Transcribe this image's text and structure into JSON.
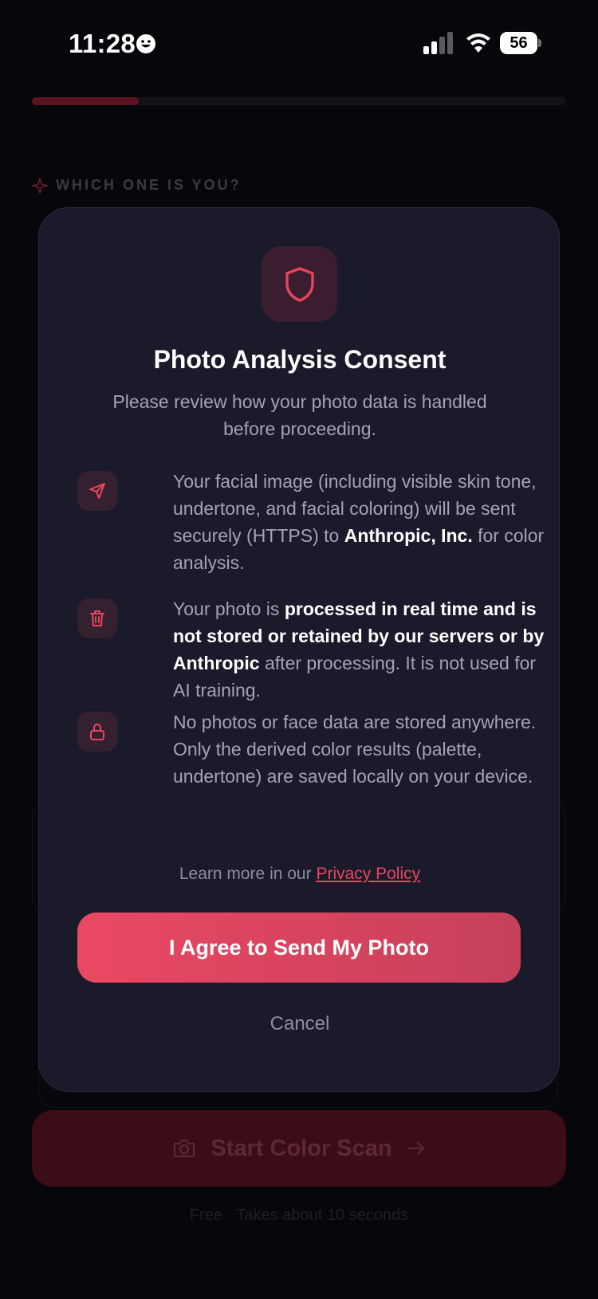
{
  "status_bar": {
    "time": "11:28",
    "battery": "56"
  },
  "progress": {
    "fraction": 0.2
  },
  "background": {
    "section_label": "WHICH ONE IS YOU?",
    "start_button": "Start Color Scan",
    "footnote": "Free · Takes about 10 seconds"
  },
  "modal": {
    "title": "Photo Analysis Consent",
    "subtitle": "Please review how your photo data is handled before proceeding.",
    "items": [
      {
        "icon": "send-icon",
        "pre": "Your facial image (including visible skin tone, undertone, and facial coloring) will be sent securely (HTTPS) to ",
        "bold": "Anthropic, Inc.",
        "post": " for color analysis."
      },
      {
        "icon": "trash-icon",
        "pre": "Your photo is ",
        "bold": "processed in real time and is not stored or retained by our servers or by Anthropic",
        "post": " after processing. It is not used for AI training."
      },
      {
        "icon": "lock-icon",
        "pre": "No photos or face data are stored anywhere. Only the derived color results (palette, undertone) are saved locally on your device.",
        "bold": "",
        "post": ""
      }
    ],
    "learn_more_prefix": "Learn more in our ",
    "privacy_link": "Privacy Policy",
    "agree_button": "I Agree to Send My Photo",
    "cancel_button": "Cancel"
  },
  "colors": {
    "accent": "#e8465f",
    "modal_bg": "#1a1a2b",
    "page_bg": "#06060b"
  }
}
